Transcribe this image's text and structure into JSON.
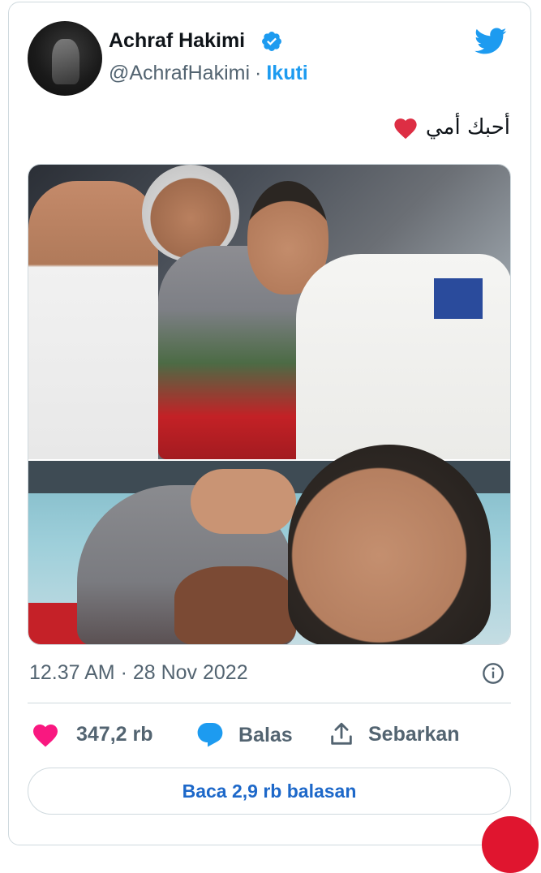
{
  "author": {
    "name": "Achraf Hakimi",
    "handle": "@AchrafHakimi",
    "separator": "·",
    "follow_label": "Ikuti",
    "verified_icon": "verified-badge-icon"
  },
  "tweet": {
    "text": "أحبك أمي",
    "emoji": "red-heart-icon",
    "timestamp": "12.37 AM · 28 Nov 2022"
  },
  "actions": {
    "likes_count": "347,2 rb",
    "reply_label": "Balas",
    "share_label": "Sebarkan"
  },
  "replies_button": "Baca 2,9 rb balasan",
  "colors": {
    "brand_blue": "#1d9bf0",
    "like_pink": "#f91880",
    "link_blue": "#1d68c9",
    "muted": "#536471"
  }
}
